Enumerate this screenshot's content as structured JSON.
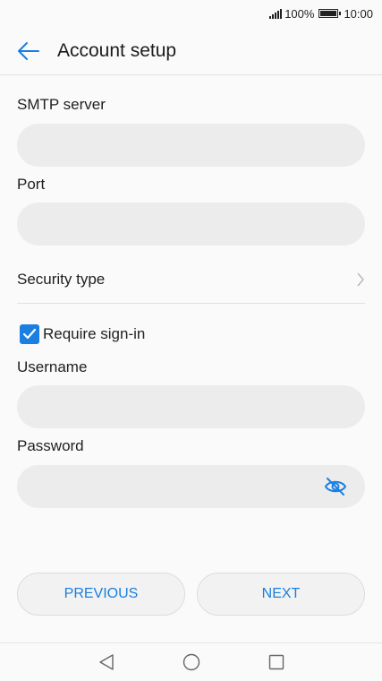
{
  "status_bar": {
    "battery": "100%",
    "time": "10:00",
    "icons": [
      "signal-icon",
      "battery-icon"
    ]
  },
  "app_bar": {
    "title": "Account setup",
    "back_icon": "arrow-left-icon"
  },
  "form": {
    "smtp_server": {
      "label": "SMTP server",
      "value": ""
    },
    "port": {
      "label": "Port",
      "value": ""
    },
    "security_type": {
      "label": "Security type",
      "icon": "chevron-right-icon"
    },
    "require_signin": {
      "label": "Require sign-in",
      "checked": true
    },
    "username": {
      "label": "Username",
      "value": ""
    },
    "password": {
      "label": "Password",
      "value": "",
      "toggle_icon": "eye-off-icon"
    }
  },
  "buttons": {
    "previous": "PREVIOUS",
    "next": "NEXT"
  },
  "colors": {
    "accent": "#1a7fe0",
    "background": "#fafafa",
    "input_background": "#ececec"
  },
  "nav_bar": {
    "icons": [
      "back-triangle-icon",
      "home-circle-icon",
      "recents-square-icon"
    ]
  }
}
